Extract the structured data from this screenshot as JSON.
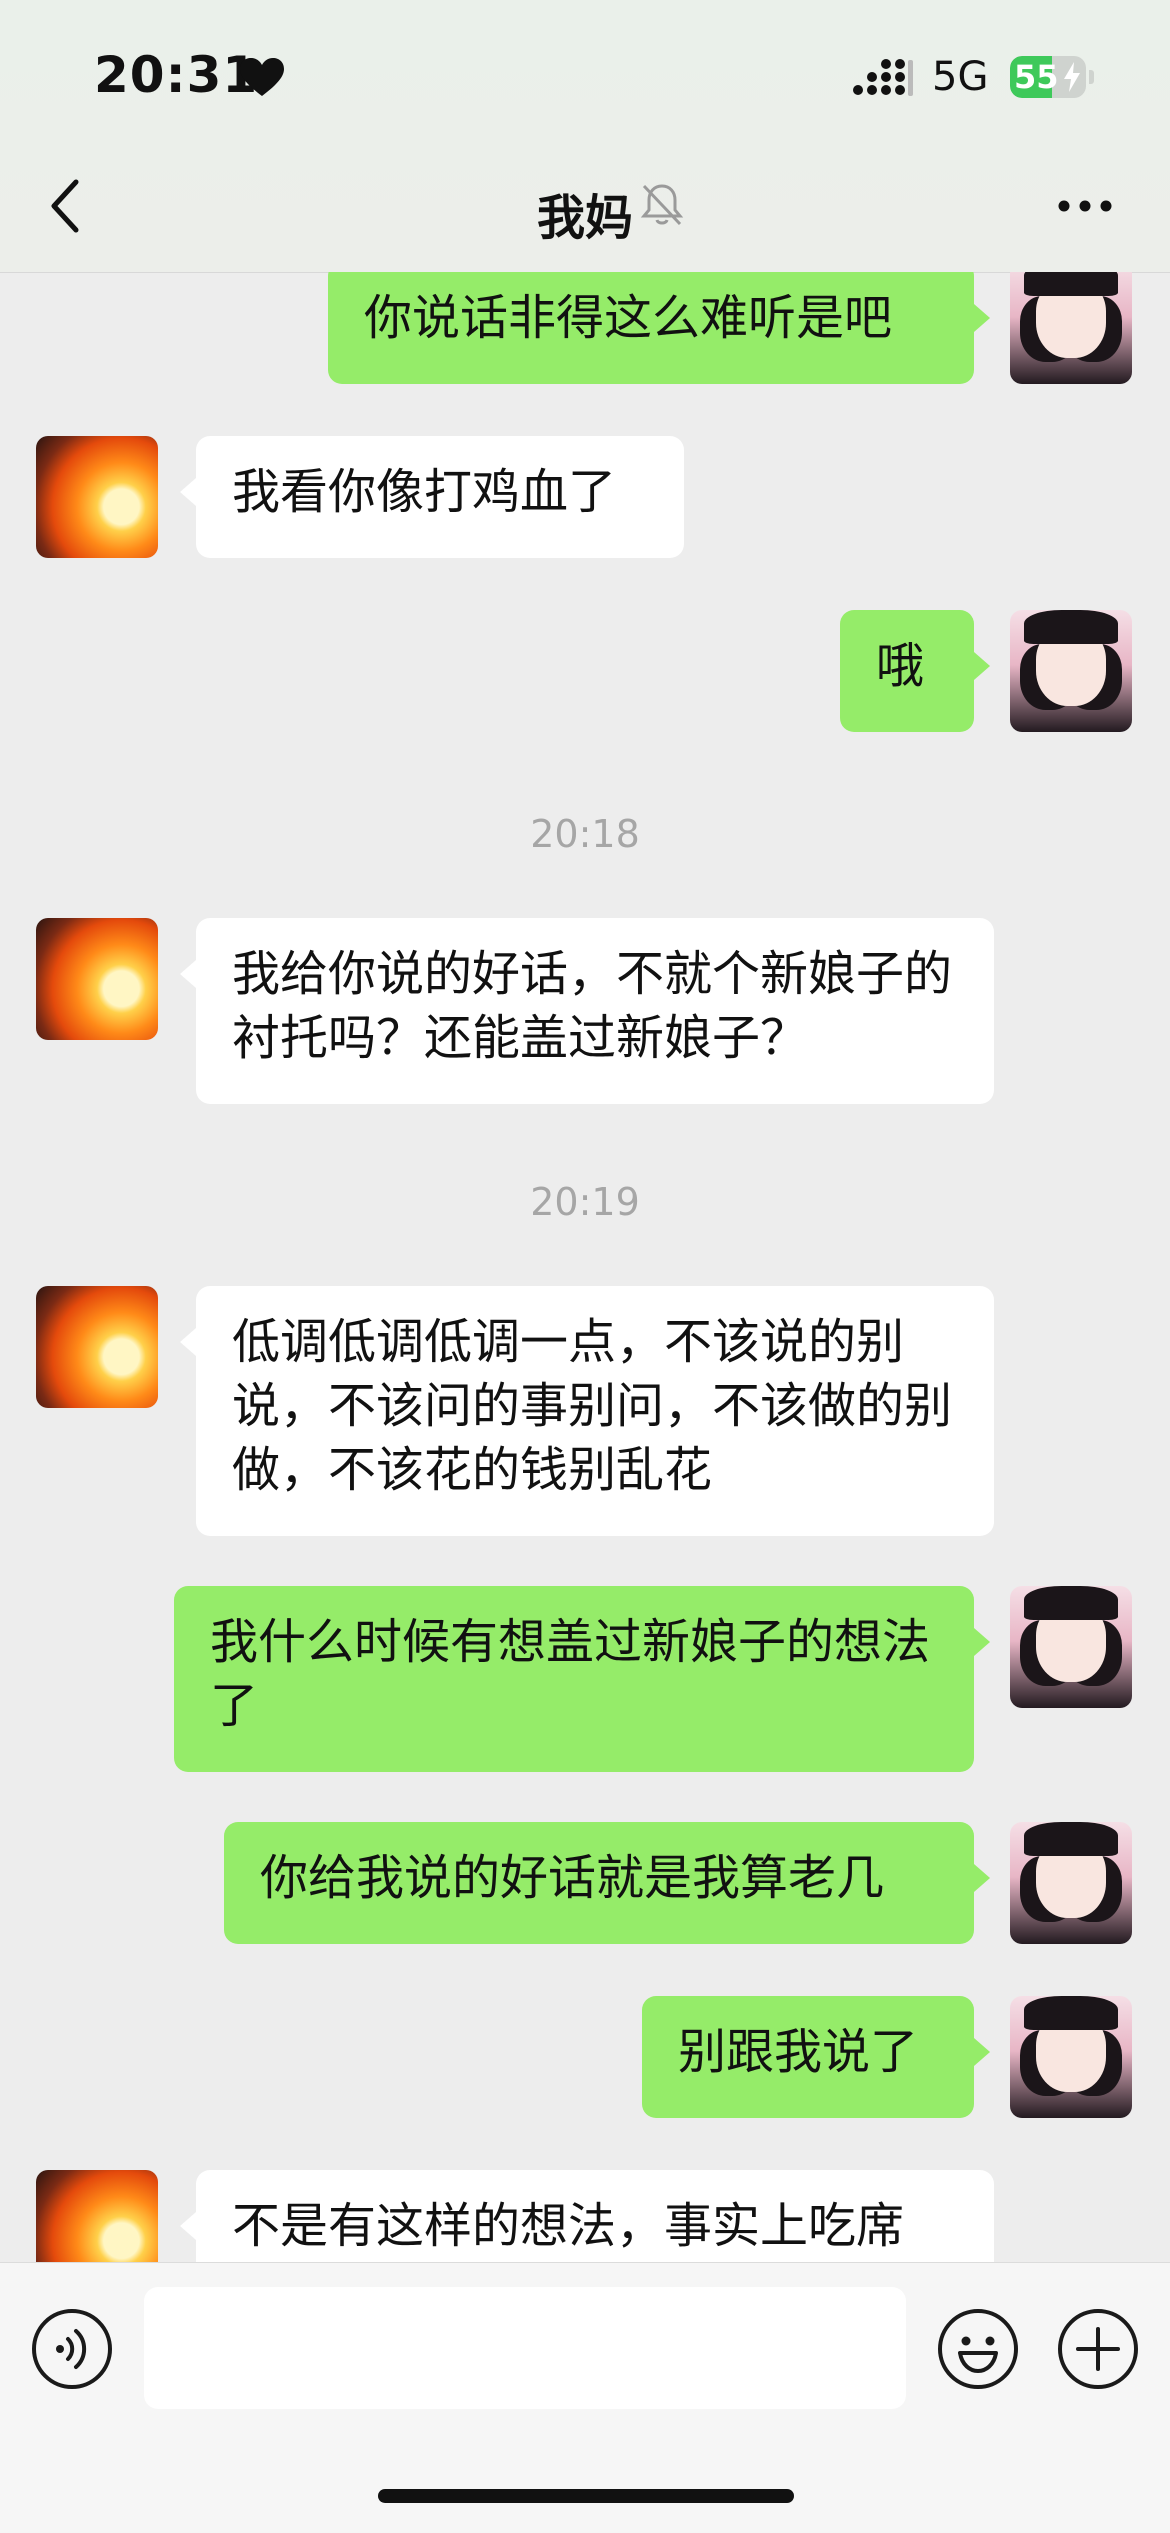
{
  "status_bar": {
    "time": "20:31",
    "network": "5G",
    "battery_level": "55",
    "battery_fraction": 0.55,
    "charging": true
  },
  "header": {
    "title": "我妈",
    "muted": true,
    "back_icon": "chevron-left-icon",
    "more_icon": "ellipsis-icon"
  },
  "messages": [
    {
      "side": "right",
      "text": "你说话非得这么难听是吧"
    },
    {
      "side": "left",
      "text": "我看你像打鸡血了"
    },
    {
      "side": "right",
      "text": "哦"
    },
    {
      "type": "time",
      "text": "20:18"
    },
    {
      "side": "left",
      "text": "我给你说的好话，不就个新娘子的衬托吗？还能盖过新娘子？"
    },
    {
      "type": "time",
      "text": "20:19"
    },
    {
      "side": "left",
      "text": "低调低调低调一点，不该说的别说，不该问的事别问，不该做的别做，不该花的钱别乱花"
    },
    {
      "side": "right",
      "text": "我什么时候有想盖过新娘子的想法了"
    },
    {
      "side": "right",
      "text": "你给我说的好话就是我算老几"
    },
    {
      "side": "right",
      "text": "别跟我说了"
    },
    {
      "side": "left",
      "text": "不是有这样的想法，事实上吃席"
    }
  ],
  "input_bar": {
    "value": "",
    "voice_icon": "voice-icon",
    "emoji_icon": "emoji-icon",
    "plus_icon": "plus-icon"
  },
  "colors": {
    "sent_bubble": "#95ec69",
    "received_bubble": "#ffffff",
    "background": "#ededed"
  }
}
